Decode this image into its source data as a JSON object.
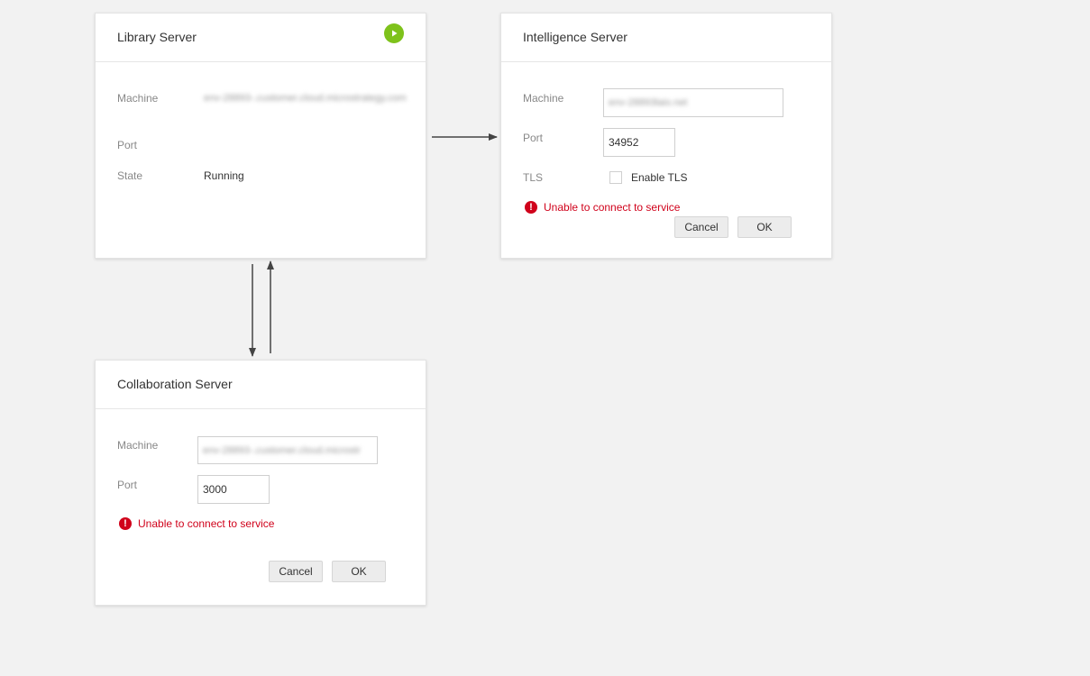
{
  "library": {
    "title": "Library Server",
    "machine_label": "Machine",
    "machine_value": "env-28893-.customer.cloud.microstrategy.com",
    "port_label": "Port",
    "port_value": "",
    "state_label": "State",
    "state_value": "Running",
    "run_icon": "play-icon",
    "run_color": "#7ec21b"
  },
  "intelligence": {
    "title": "Intelligence Server",
    "machine_label": "Machine",
    "machine_value": "env-28893laio.net",
    "port_label": "Port",
    "port_value": "34952",
    "tls_label": "TLS",
    "tls_checkbox_label": "Enable TLS",
    "tls_checked": false,
    "error_text": "Unable to connect to service",
    "cancel_label": "Cancel",
    "ok_label": "OK"
  },
  "collaboration": {
    "title": "Collaboration Server",
    "machine_label": "Machine",
    "machine_value": "env-28893-.customer.cloud.microstr",
    "port_label": "Port",
    "port_value": "3000",
    "error_text": "Unable to connect to service",
    "cancel_label": "Cancel",
    "ok_label": "OK"
  },
  "colors": {
    "error": "#d0021b",
    "background": "#f2f2f2",
    "arrow": "#444444"
  }
}
